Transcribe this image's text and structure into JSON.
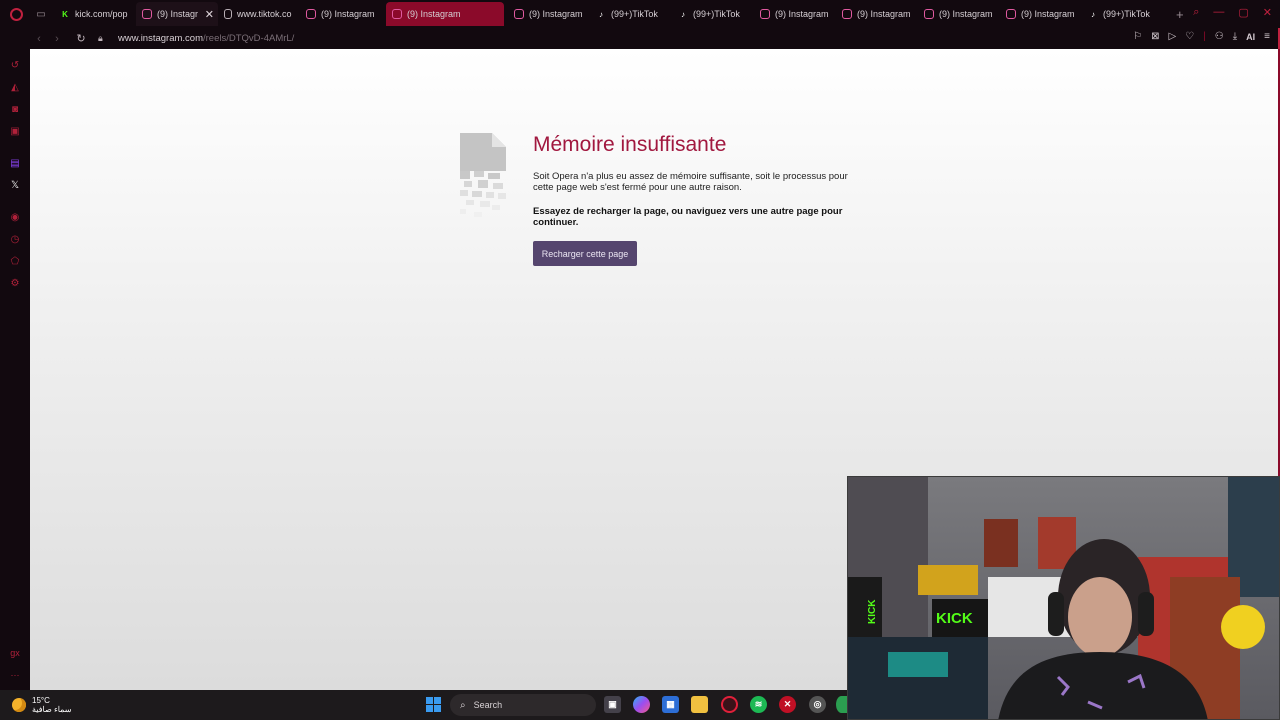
{
  "tabs": [
    {
      "title": "kick.com/pop",
      "icon": "kick-icon",
      "favicon": "K",
      "state": "normal"
    },
    {
      "title": "(9) Instagr",
      "icon": "instagram-icon",
      "favicon": "",
      "state": "hover",
      "close": "✕"
    },
    {
      "title": "www.tiktok.co",
      "icon": "document-icon",
      "favicon": "",
      "state": "normal"
    },
    {
      "title": "(9) Instagram",
      "icon": "instagram-icon",
      "favicon": "",
      "state": "normal"
    },
    {
      "title": "(9) Instagram",
      "icon": "instagram-icon",
      "favicon": "",
      "state": "active"
    },
    {
      "title": "(9) Instagram",
      "icon": "instagram-icon",
      "favicon": "",
      "state": "normal"
    },
    {
      "title": "(99+)TikTok",
      "icon": "tiktok-icon",
      "favicon": "♪",
      "state": "normal"
    },
    {
      "title": "(99+)TikTok",
      "icon": "tiktok-icon",
      "favicon": "♪",
      "state": "normal"
    },
    {
      "title": "(9) Instagram",
      "icon": "instagram-icon",
      "favicon": "",
      "state": "normal"
    },
    {
      "title": "(9) Instagram",
      "icon": "instagram-icon",
      "favicon": "",
      "state": "normal"
    },
    {
      "title": "(9) Instagram",
      "icon": "instagram-icon",
      "favicon": "",
      "state": "normal"
    },
    {
      "title": "(9) Instagram",
      "icon": "instagram-icon",
      "favicon": "",
      "state": "normal"
    },
    {
      "title": "(99+)TikTok",
      "icon": "tiktok-icon",
      "favicon": "♪",
      "state": "normal"
    }
  ],
  "address": {
    "host": "www.instagram.com",
    "path": "/reels/DTQvD-4AMrL/"
  },
  "toolbar": {
    "ai_label": "AI"
  },
  "error": {
    "title": "Mémoire insuffisante",
    "description": "Soit Opera n'a plus eu assez de mémoire suffisante, soit le processus pour cette page web s'est fermé pour une autre raison.",
    "hint": "Essayez de recharger la page, ou naviguez vers une autre page pour continuer.",
    "reload_button": "Recharger cette page"
  },
  "taskbar": {
    "temperature": "15°C",
    "weather_desc": "سماء صافية",
    "search_placeholder": "Search"
  },
  "colors": {
    "accent": "#c0213f",
    "active_tab": "#8b0a2a",
    "error_title": "#a1183f",
    "reload_button": "#55456e"
  },
  "webcam": {
    "signs": [
      "KICK",
      "KICK"
    ]
  }
}
